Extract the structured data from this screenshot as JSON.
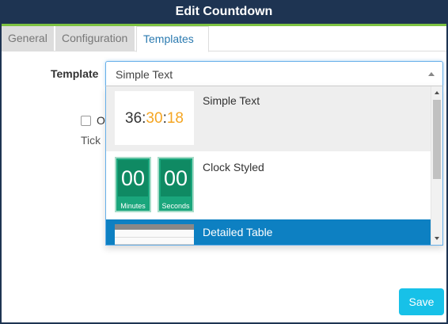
{
  "dialog": {
    "title": "Edit Countdown"
  },
  "tabs": [
    {
      "label": "General"
    },
    {
      "label": "Configuration"
    },
    {
      "label": "Templates"
    }
  ],
  "form": {
    "template_label": "Template",
    "partial_checkbox_text": "O",
    "partial_tick_text": "Tick"
  },
  "select": {
    "value": "Simple Text"
  },
  "options": [
    {
      "label": "Simple Text",
      "preview": {
        "hours": "36",
        "sep1": ":",
        "minutes": "30",
        "sep2": ":",
        "seconds": "18"
      }
    },
    {
      "label": "Clock Styled",
      "preview": {
        "digit1": "00",
        "caption1": "Minutes",
        "digit2": "00",
        "caption2": "Seconds"
      }
    },
    {
      "label": "Detailed Table",
      "selected": true
    }
  ],
  "footer": {
    "save_label": "Save"
  },
  "colors": {
    "header": "#1e3452",
    "accent": "#7dc242",
    "link": "#2a7ab0",
    "highlight": "#0d80c2",
    "save": "#17c1e8",
    "clock_green": "#1aa67c",
    "orange": "#f5a623"
  }
}
